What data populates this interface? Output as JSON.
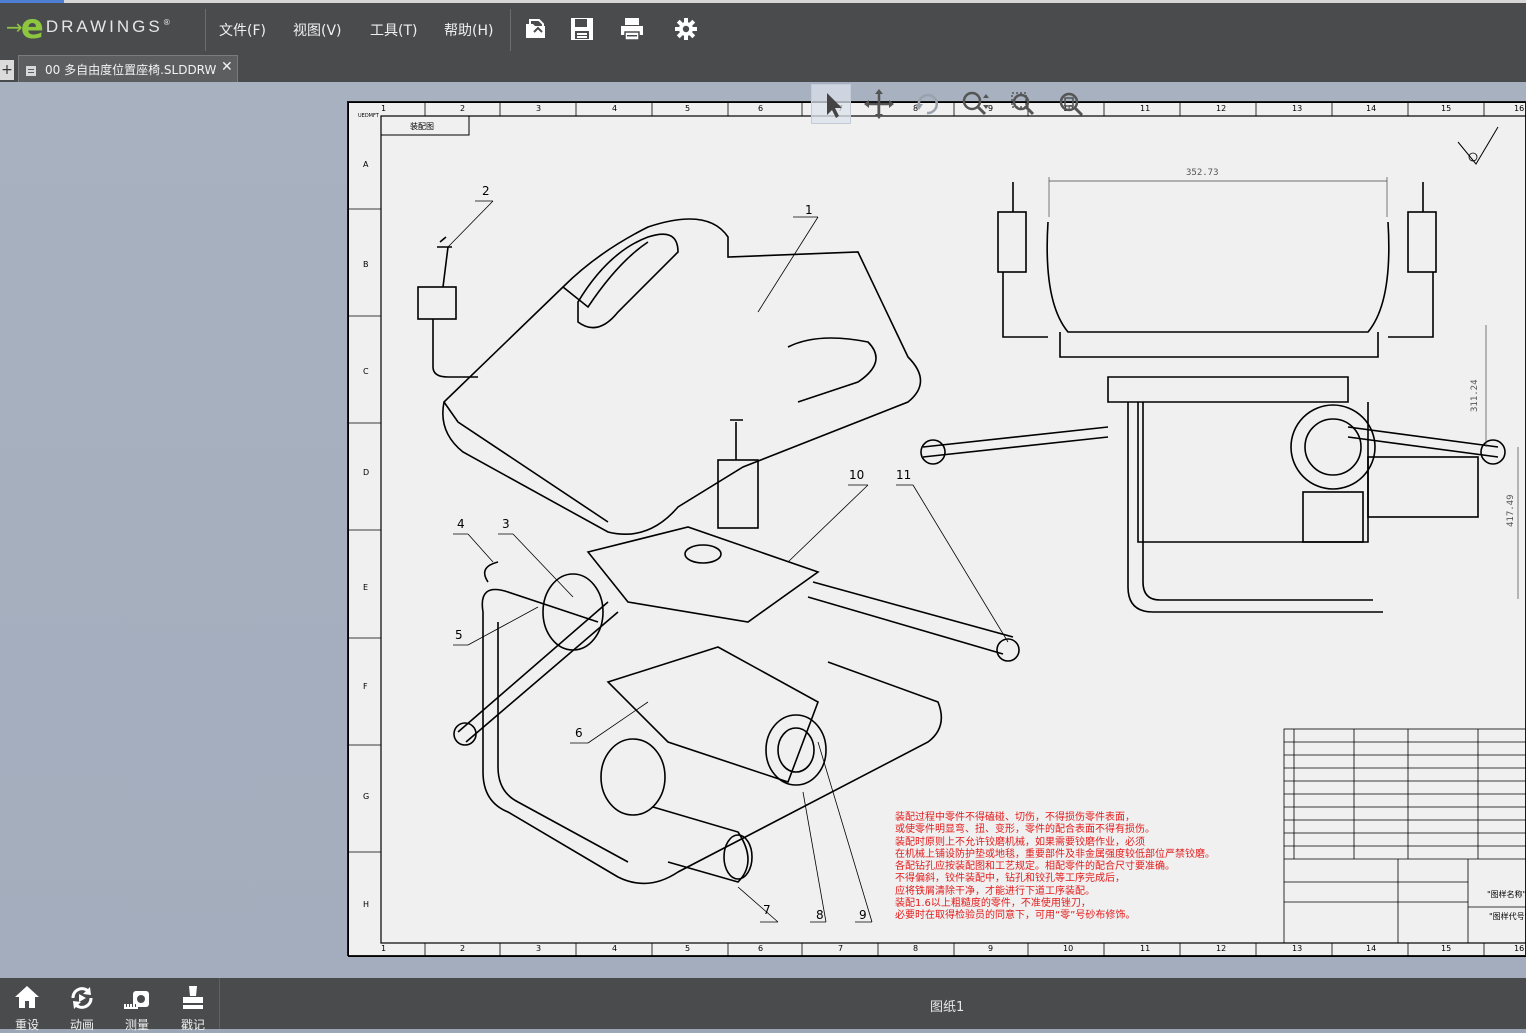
{
  "app": {
    "logo_text": "DRAWINGS",
    "logo_letter": "e",
    "logo_arrow": "→",
    "registered": "®"
  },
  "menu": [
    {
      "label": "文件(F)"
    },
    {
      "label": "视图(V)"
    },
    {
      "label": "工具(T)"
    },
    {
      "label": "帮助(H)"
    }
  ],
  "toolbar": {
    "icons": [
      "open-folder-icon",
      "save-icon",
      "print-icon",
      "settings-gear-icon"
    ]
  },
  "tabs": {
    "add_label": "+",
    "active": {
      "name": "00 多自由度位置座椅.SLDDRW",
      "close": "✕"
    }
  },
  "view_tools": {
    "icons": [
      "select-arrow-icon",
      "pan-icon",
      "rotate-icon",
      "zoom-icon",
      "zoom-to-area-icon",
      "zoom-to-fit-icon"
    ]
  },
  "sheet": {
    "top_left_label": "UEDMFT",
    "title_block_small": "装配图",
    "column_numbers": [
      "1",
      "2",
      "3",
      "4",
      "5",
      "6",
      "7",
      "8",
      "9",
      "10",
      "11",
      "12",
      "13",
      "14",
      "15",
      "16"
    ],
    "row_letters": [
      "A",
      "B",
      "C",
      "D",
      "E",
      "F",
      "G",
      "H"
    ],
    "balloons": [
      "1",
      "2",
      "3",
      "4",
      "5",
      "6",
      "7",
      "8",
      "9",
      "10",
      "11"
    ],
    "dimensions": {
      "width": "352.73",
      "height_a": "311.24",
      "height_b": "417.49"
    },
    "notes": [
      "装配过程中零件不得磕碰、切伤，不得损伤零件表面，",
      "或使零件明显弯、扭、变形，零件的配合表面不得有损伤。",
      "装配时原则上不允许铰磨机械，如果需要铰磨作业，必须",
      "在机械上铺设防护垫或地毯，重要部件及非金属强度较低部位严禁铰磨。",
      "各配钻孔应按装配图和工艺规定。相配零件的配合尺寸要准确。",
      "不得偏斜，铰件装配中，钻孔和铰孔等工序完成后，",
      "应将铁屑清除干净，才能进行下道工序装配。",
      "装配1.6以上粗糙度的零件，不准使用锉刀，",
      "必要时在取得检验员的同意下，可用“零”号砂布修饰。"
    ],
    "title_block": {
      "drawing_name": "\"图样名称\"",
      "drawing_number": "\"图样代号\""
    }
  },
  "bottom": {
    "buttons": [
      {
        "label": "重设",
        "icon": "home-icon"
      },
      {
        "label": "动画",
        "icon": "animate-icon"
      },
      {
        "label": "测量",
        "icon": "measure-icon"
      },
      {
        "label": "戳记",
        "icon": "stamp-icon"
      }
    ],
    "sheet_tab": "图纸1"
  },
  "colors": {
    "chrome": "#4a4b4d",
    "logo_green": "#8dc63f",
    "workspace": "#a5afbe",
    "sheet": "#f0f0f0",
    "note_red": "#e31b1b"
  }
}
